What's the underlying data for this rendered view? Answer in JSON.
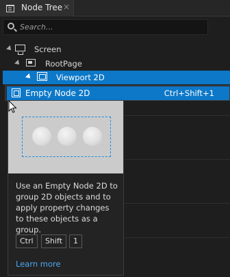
{
  "tab": {
    "label": "Node Tree",
    "close": "×"
  },
  "search": {
    "placeholder": "Search..."
  },
  "tree": {
    "items": [
      {
        "label": "Screen"
      },
      {
        "label": "RootPage"
      },
      {
        "label": "Viewport 2D"
      }
    ]
  },
  "menu": {
    "item_label": "Empty Node 2D",
    "shortcut": "Ctrl+Shift+1"
  },
  "tooltip": {
    "description": "Use an Empty Node 2D to group 2D objects and to apply property changes to these objects as a group.",
    "keys": [
      "Ctrl",
      "Shift",
      "1"
    ],
    "learn_more": "Learn more"
  },
  "colors": {
    "selection": "#0d78c8",
    "link": "#4ea7f0",
    "background": "#1e1e1e"
  },
  "icons": [
    "node-tree-icon",
    "search-icon",
    "screen-icon",
    "root-page-icon",
    "viewport-2d-icon",
    "empty-node-2d-icon",
    "mouse-cursor-icon"
  ]
}
